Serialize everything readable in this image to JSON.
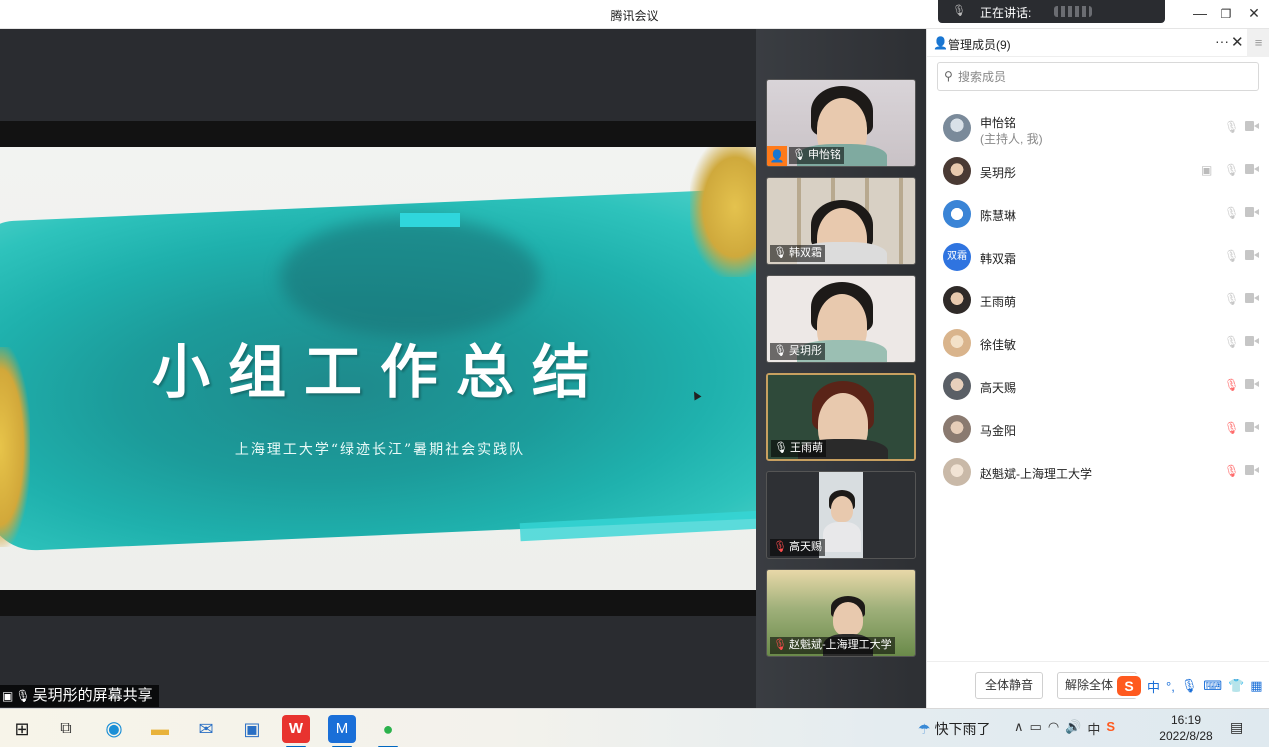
{
  "window": {
    "title": "腾讯会议",
    "speaking_label": "正在讲话:",
    "minimize": "—",
    "restore": "❐",
    "close": "✕"
  },
  "share": {
    "slide_title": "小组工作总结",
    "slide_subtitle": "上海理工大学“绿迹长江”暑期社会实践队",
    "sharer_label": "吴玥彤的屏幕共享"
  },
  "videos": [
    {
      "name": "申怡铭",
      "host": true,
      "mic": "on"
    },
    {
      "name": "韩双霜",
      "host": false,
      "mic": "on"
    },
    {
      "name": "吴玥彤",
      "host": false,
      "mic": "on"
    },
    {
      "name": "王雨萌",
      "host": false,
      "mic": "on"
    },
    {
      "name": "高天赐",
      "host": false,
      "mic": "off"
    },
    {
      "name": "赵魁斌-上海理工大学",
      "host": false,
      "mic": "off"
    }
  ],
  "panel": {
    "title": "管理成员(9)",
    "more": "···",
    "close": "✕",
    "side_toggle": "≡",
    "search_placeholder": "搜索成员",
    "members": [
      {
        "name": "申怡铭",
        "sub": "(主持人, 我)",
        "avatar": "",
        "avatar_color": "#7a8a9a",
        "mic": "on",
        "sharing": false
      },
      {
        "name": "吴玥彤",
        "sub": "",
        "avatar": "",
        "avatar_color": "#4a3a34",
        "mic": "on",
        "sharing": true
      },
      {
        "name": "陈慧琳",
        "sub": "",
        "avatar": "",
        "avatar_color": "#3a84d6",
        "mic": "on",
        "sharing": false
      },
      {
        "name": "韩双霜",
        "sub": "",
        "avatar": "双霜",
        "avatar_color": "#2f74e0",
        "mic": "on",
        "sharing": false
      },
      {
        "name": "王雨萌",
        "sub": "",
        "avatar": "",
        "avatar_color": "#2f2a28",
        "mic": "on",
        "sharing": false
      },
      {
        "name": "徐佳敏",
        "sub": "",
        "avatar": "",
        "avatar_color": "#d9b48c",
        "mic": "on",
        "sharing": false
      },
      {
        "name": "高天赐",
        "sub": "",
        "avatar": "",
        "avatar_color": "#5a5f66",
        "mic": "off",
        "sharing": false
      },
      {
        "name": "马金阳",
        "sub": "",
        "avatar": "",
        "avatar_color": "#8a7a70",
        "mic": "off",
        "sharing": false
      },
      {
        "name": "赵魁斌-上海理工大学",
        "sub": "",
        "avatar": "",
        "avatar_color": "#c9b9a8",
        "mic": "off",
        "sharing": false
      }
    ],
    "mute_all": "全体静音",
    "unmute_all": "解除全体"
  },
  "ime": {
    "logo": "S",
    "lang": "中",
    "punct": "°,"
  },
  "taskbar": {
    "weather_text": "快下雨了",
    "ime_tray": "中",
    "time": "16:19",
    "date": "2022/8/28"
  },
  "colors": {
    "accent": "#1a6fd8",
    "mic_off": "#ff5a5a",
    "host_badge": "#ff7a1a",
    "slide_teal": "#1fb1ad",
    "slide_gold": "#e4c24e"
  }
}
